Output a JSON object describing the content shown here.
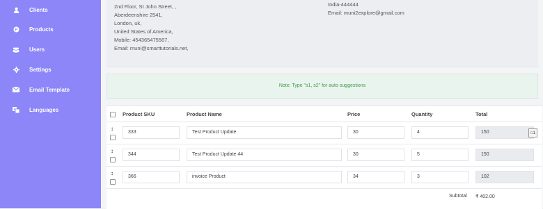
{
  "sidebar": {
    "items": [
      {
        "label": "Clients",
        "icon": "user-icon"
      },
      {
        "label": "Products",
        "icon": "product-icon"
      },
      {
        "label": "Users",
        "icon": "users-icon"
      },
      {
        "label": "Settings",
        "icon": "gear-icon"
      },
      {
        "label": "Email Template",
        "icon": "envelope-icon"
      },
      {
        "label": "Languages",
        "icon": "language-icon"
      }
    ],
    "bg": "#8c86f8"
  },
  "from_address": {
    "lines": [
      "2nd Floor, St John Street, ,",
      "Aberdeenshire 2541,",
      "London, uk,",
      "United States of America,",
      "Mobile: 454365475567,",
      "Email: muni@smarttutorials.net,"
    ]
  },
  "to_address": {
    "lines": [
      "India-444444",
      "Email: muni2explore@gmail.com"
    ]
  },
  "note": "Note: Type \"s1, s2\" for auto suggestions",
  "table": {
    "headers": {
      "sku": "Product SKU",
      "name": "Product Name",
      "price": "Price",
      "qty": "Quantity",
      "total": "Total"
    },
    "rows": [
      {
        "sku": "333",
        "name": "Test Product Update",
        "price": "30",
        "qty": "4",
        "total": "150"
      },
      {
        "sku": "344",
        "name": "Test Product Update 44",
        "price": "30",
        "qty": "5",
        "total": "150"
      },
      {
        "sku": "366",
        "name": "invoice Product",
        "price": "34",
        "qty": "3",
        "total": "102"
      }
    ],
    "mini_control": "□1",
    "drag_symbol": "↕",
    "subtotal_label": "Subtotal",
    "subtotal_value": "₹ 402.00"
  }
}
